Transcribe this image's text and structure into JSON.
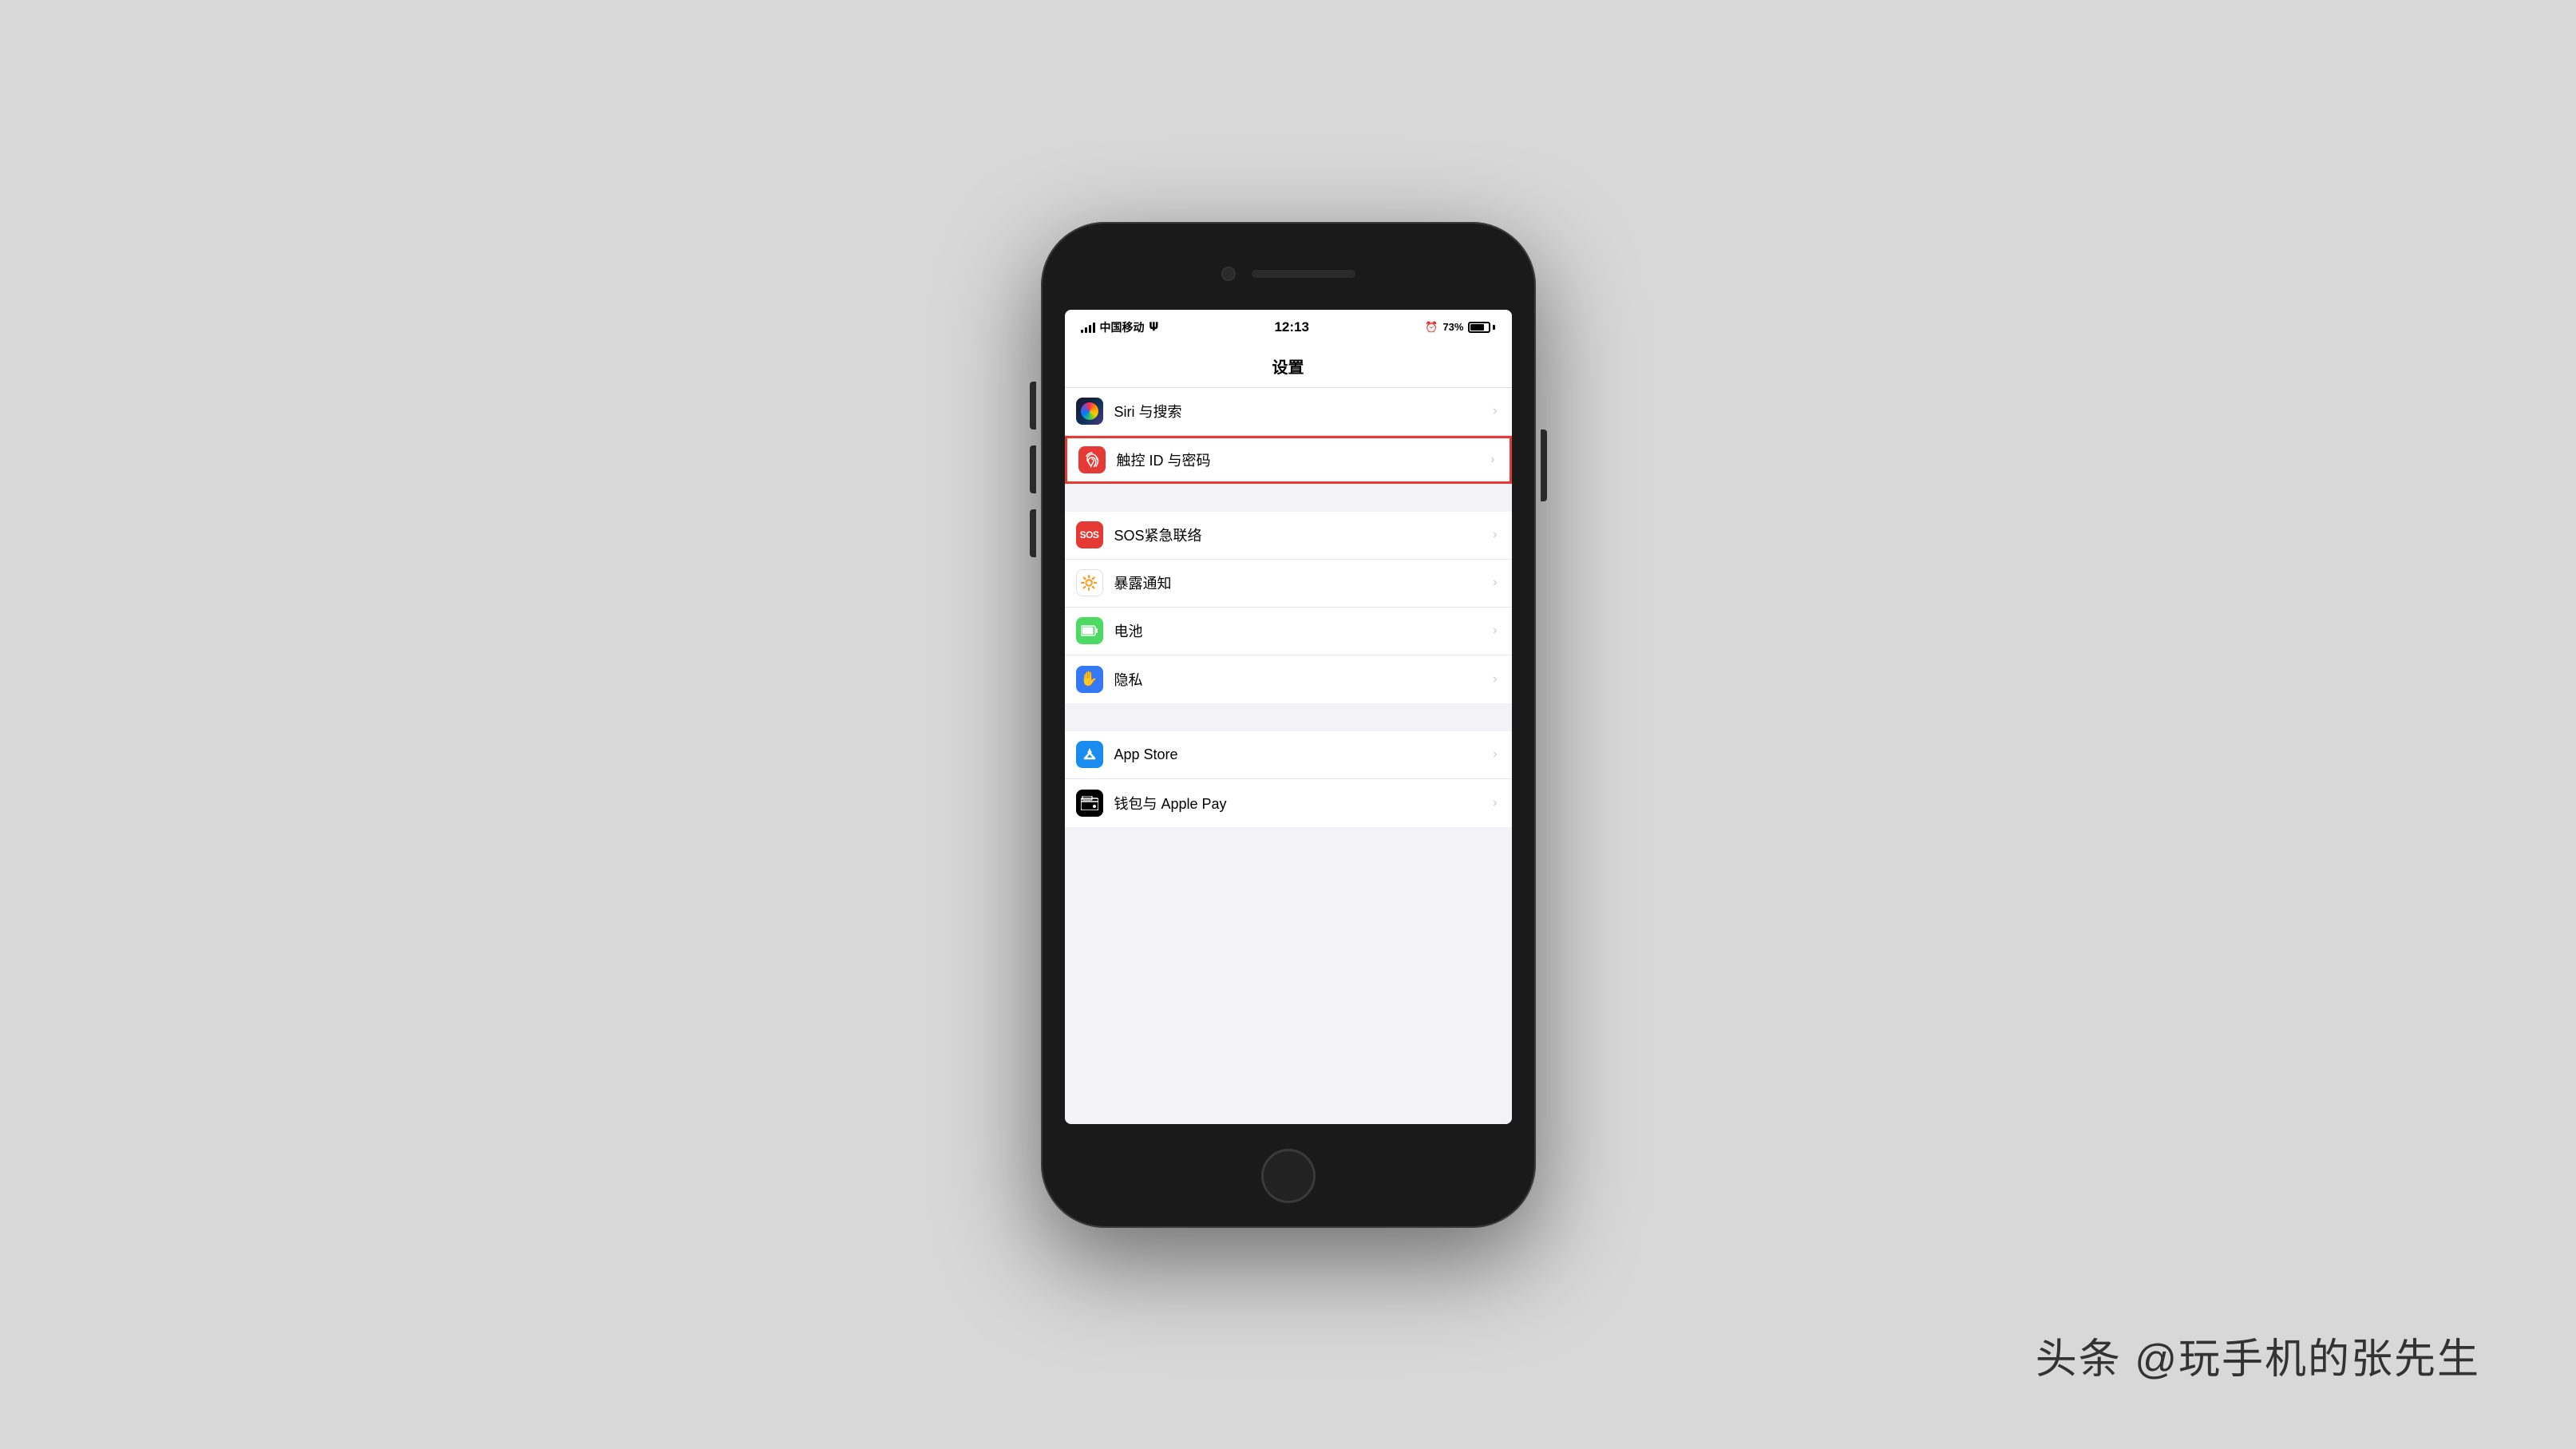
{
  "background": "#d8d8d8",
  "watermark": "头条 @玩手机的张先生",
  "phone": {
    "statusBar": {
      "carrier": "中国移动",
      "time": "12:13",
      "batteryPercent": "73%"
    },
    "navTitle": "设置",
    "sections": [
      {
        "id": "section1",
        "rows": [
          {
            "id": "siri",
            "icon": "siri",
            "label": "Siri 与搜索",
            "highlighted": false
          },
          {
            "id": "touchid",
            "icon": "touchid",
            "label": "触控 ID 与密码",
            "highlighted": true
          }
        ]
      },
      {
        "id": "section2",
        "rows": [
          {
            "id": "sos",
            "icon": "sos",
            "label": "SOS紧急联络",
            "highlighted": false
          },
          {
            "id": "exposure",
            "icon": "exposure",
            "label": "暴露通知",
            "highlighted": false
          },
          {
            "id": "battery",
            "icon": "battery",
            "label": "电池",
            "highlighted": false
          },
          {
            "id": "privacy",
            "icon": "privacy",
            "label": "隐私",
            "highlighted": false
          }
        ]
      },
      {
        "id": "section3",
        "rows": [
          {
            "id": "appstore",
            "icon": "appstore",
            "label": "App Store",
            "highlighted": false
          },
          {
            "id": "wallet",
            "icon": "wallet",
            "label": "钱包与 Apple Pay",
            "highlighted": false
          }
        ]
      }
    ]
  }
}
